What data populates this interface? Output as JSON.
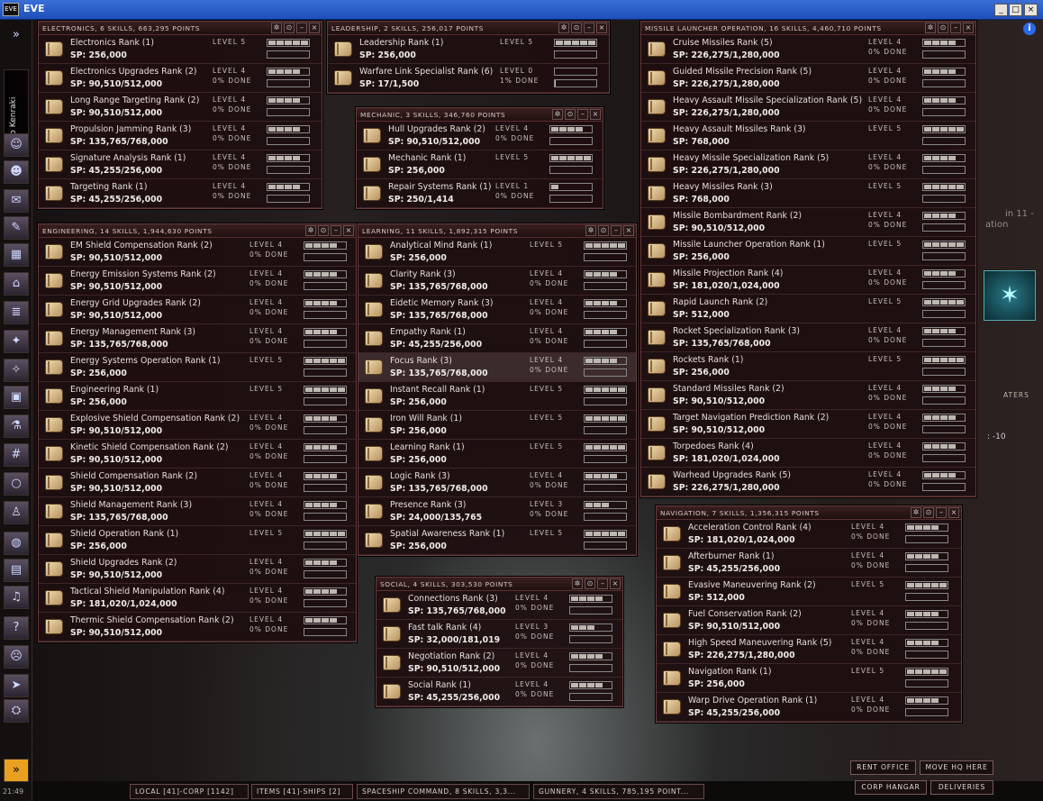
{
  "window": {
    "title": "EVE",
    "logo": "EVE",
    "controls": [
      "_",
      "□",
      "×"
    ]
  },
  "clock": "21:49",
  "character": {
    "name": "Tiso Kenraki"
  },
  "sidebar": {
    "icons": [
      {
        "name": "expand-icon",
        "glyph": "»"
      },
      {
        "name": "character-sheet-icon",
        "glyph": "☺"
      },
      {
        "name": "people-icon",
        "glyph": "☻"
      },
      {
        "name": "mail-icon",
        "glyph": "✉"
      },
      {
        "name": "notepad-icon",
        "glyph": "✎"
      },
      {
        "name": "assets-icon",
        "glyph": "▦"
      },
      {
        "name": "corporation-icon",
        "glyph": "⌂"
      },
      {
        "name": "contracts-icon",
        "glyph": "≣"
      },
      {
        "name": "map-icon",
        "glyph": "✦"
      },
      {
        "name": "starmap-icon",
        "glyph": "✧"
      },
      {
        "name": "wallet-icon",
        "glyph": "▣"
      },
      {
        "name": "science-icon",
        "glyph": "⚗"
      },
      {
        "name": "calculator-icon",
        "glyph": "#"
      },
      {
        "name": "help-lifebuoy-icon",
        "glyph": "○"
      },
      {
        "name": "pilot-icon",
        "glyph": "♙"
      },
      {
        "name": "world-icon",
        "glyph": "◍"
      },
      {
        "name": "journal-icon",
        "glyph": "▤"
      },
      {
        "name": "music-icon",
        "glyph": "♫"
      },
      {
        "name": "help-icon",
        "glyph": "?"
      },
      {
        "name": "agent-icon",
        "glyph": "☹"
      },
      {
        "name": "ship-icon",
        "glyph": "➤"
      },
      {
        "name": "station-icon",
        "glyph": "⛭"
      },
      {
        "name": "collapse-chevrons-icon",
        "glyph": "»"
      }
    ]
  },
  "panels": [
    {
      "id": "electronics",
      "title": "ELECTRONICS, 6 SKILLS, 663,295 POINTS",
      "skills": [
        {
          "name": "Electronics Rank (1)",
          "sp": "SP: 256,000",
          "level": "LEVEL 5",
          "done": "",
          "lvl": 5,
          "progress": 0
        },
        {
          "name": "Electronics Upgrades Rank (2)",
          "sp": "SP: 90,510/512,000",
          "level": "LEVEL 4",
          "done": "0% DONE",
          "lvl": 4,
          "progress": 0
        },
        {
          "name": "Long Range Targeting Rank (2)",
          "sp": "SP: 90,510/512,000",
          "level": "LEVEL 4",
          "done": "0% DONE",
          "lvl": 4,
          "progress": 0
        },
        {
          "name": "Propulsion Jamming Rank (3)",
          "sp": "SP: 135,765/768,000",
          "level": "LEVEL 4",
          "done": "0% DONE",
          "lvl": 4,
          "progress": 0
        },
        {
          "name": "Signature Analysis Rank (1)",
          "sp": "SP: 45,255/256,000",
          "level": "LEVEL 4",
          "done": "0% DONE",
          "lvl": 4,
          "progress": 0
        },
        {
          "name": "Targeting Rank (1)",
          "sp": "SP: 45,255/256,000",
          "level": "LEVEL 4",
          "done": "0% DONE",
          "lvl": 4,
          "progress": 0
        }
      ]
    },
    {
      "id": "leadership",
      "title": "LEADERSHIP, 2 SKILLS, 256,017 POINTS",
      "skills": [
        {
          "name": "Leadership Rank (1)",
          "sp": "SP: 256,000",
          "level": "LEVEL 5",
          "done": "",
          "lvl": 5,
          "progress": 0
        },
        {
          "name": "Warfare Link Specialist Rank (6)",
          "sp": "SP: 17/1,500",
          "level": "LEVEL 0",
          "done": "1% DONE",
          "lvl": 0,
          "progress": 0.01
        }
      ]
    },
    {
      "id": "mechanic",
      "title": "MECHANIC, 3 SKILLS, 346,760 POINTS",
      "skills": [
        {
          "name": "Hull Upgrades Rank (2)",
          "sp": "SP: 90,510/512,000",
          "level": "LEVEL 4",
          "done": "0% DONE",
          "lvl": 4,
          "progress": 0
        },
        {
          "name": "Mechanic Rank (1)",
          "sp": "SP: 256,000",
          "level": "LEVEL 5",
          "done": "",
          "lvl": 5,
          "progress": 0
        },
        {
          "name": "Repair Systems Rank (1)",
          "sp": "SP: 250/1,414",
          "level": "LEVEL 1",
          "done": "0% DONE",
          "lvl": 1,
          "progress": 0
        }
      ]
    },
    {
      "id": "engineering",
      "title": "ENGINEERING, 14 SKILLS, 1,944,630 POINTS",
      "skills": [
        {
          "name": "EM Shield Compensation Rank (2)",
          "sp": "SP: 90,510/512,000",
          "level": "LEVEL 4",
          "done": "0% DONE",
          "lvl": 4,
          "progress": 0
        },
        {
          "name": "Energy Emission Systems Rank (2)",
          "sp": "SP: 90,510/512,000",
          "level": "LEVEL 4",
          "done": "0% DONE",
          "lvl": 4,
          "progress": 0
        },
        {
          "name": "Energy Grid Upgrades Rank (2)",
          "sp": "SP: 90,510/512,000",
          "level": "LEVEL 4",
          "done": "0% DONE",
          "lvl": 4,
          "progress": 0
        },
        {
          "name": "Energy Management Rank (3)",
          "sp": "SP: 135,765/768,000",
          "level": "LEVEL 4",
          "done": "0% DONE",
          "lvl": 4,
          "progress": 0
        },
        {
          "name": "Energy Systems Operation Rank (1)",
          "sp": "SP: 256,000",
          "level": "LEVEL 5",
          "done": "",
          "lvl": 5,
          "progress": 0
        },
        {
          "name": "Engineering Rank (1)",
          "sp": "SP: 256,000",
          "level": "LEVEL 5",
          "done": "",
          "lvl": 5,
          "progress": 0
        },
        {
          "name": "Explosive Shield Compensation Rank (2)",
          "sp": "SP: 90,510/512,000",
          "level": "LEVEL 4",
          "done": "0% DONE",
          "lvl": 4,
          "progress": 0
        },
        {
          "name": "Kinetic Shield Compensation Rank (2)",
          "sp": "SP: 90,510/512,000",
          "level": "LEVEL 4",
          "done": "0% DONE",
          "lvl": 4,
          "progress": 0
        },
        {
          "name": "Shield Compensation Rank (2)",
          "sp": "SP: 90,510/512,000",
          "level": "LEVEL 4",
          "done": "0% DONE",
          "lvl": 4,
          "progress": 0
        },
        {
          "name": "Shield Management Rank (3)",
          "sp": "SP: 135,765/768,000",
          "level": "LEVEL 4",
          "done": "0% DONE",
          "lvl": 4,
          "progress": 0
        },
        {
          "name": "Shield Operation Rank (1)",
          "sp": "SP: 256,000",
          "level": "LEVEL 5",
          "done": "",
          "lvl": 5,
          "progress": 0
        },
        {
          "name": "Shield Upgrades Rank (2)",
          "sp": "SP: 90,510/512,000",
          "level": "LEVEL 4",
          "done": "0% DONE",
          "lvl": 4,
          "progress": 0
        },
        {
          "name": "Tactical Shield Manipulation Rank (4)",
          "sp": "SP: 181,020/1,024,000",
          "level": "LEVEL 4",
          "done": "0% DONE",
          "lvl": 4,
          "progress": 0
        },
        {
          "name": "Thermic Shield Compensation Rank (2)",
          "sp": "SP: 90,510/512,000",
          "level": "LEVEL 4",
          "done": "0% DONE",
          "lvl": 4,
          "progress": 0
        }
      ]
    },
    {
      "id": "learning",
      "title": "LEARNING, 11 SKILLS, 1,892,315 POINTS",
      "skills": [
        {
          "name": "Analytical Mind Rank (1)",
          "sp": "SP: 256,000",
          "level": "LEVEL 5",
          "done": "",
          "lvl": 5,
          "progress": 0
        },
        {
          "name": "Clarity Rank (3)",
          "sp": "SP: 135,765/768,000",
          "level": "LEVEL 4",
          "done": "0% DONE",
          "lvl": 4,
          "progress": 0
        },
        {
          "name": "Eidetic Memory Rank (3)",
          "sp": "SP: 135,765/768,000",
          "level": "LEVEL 4",
          "done": "0% DONE",
          "lvl": 4,
          "progress": 0
        },
        {
          "name": "Empathy Rank (1)",
          "sp": "SP: 45,255/256,000",
          "level": "LEVEL 4",
          "done": "0% DONE",
          "lvl": 4,
          "progress": 0
        },
        {
          "name": "Focus Rank (3)",
          "sp": "SP: 135,765/768,000",
          "level": "LEVEL 4",
          "done": "0% DONE",
          "lvl": 4,
          "progress": 0,
          "selected": true
        },
        {
          "name": "Instant Recall Rank (1)",
          "sp": "SP: 256,000",
          "level": "LEVEL 5",
          "done": "",
          "lvl": 5,
          "progress": 0
        },
        {
          "name": "Iron Will Rank (1)",
          "sp": "SP: 256,000",
          "level": "LEVEL 5",
          "done": "",
          "lvl": 5,
          "progress": 0
        },
        {
          "name": "Learning Rank (1)",
          "sp": "SP: 256,000",
          "level": "LEVEL 5",
          "done": "",
          "lvl": 5,
          "progress": 0
        },
        {
          "name": "Logic Rank (3)",
          "sp": "SP: 135,765/768,000",
          "level": "LEVEL 4",
          "done": "0% DONE",
          "lvl": 4,
          "progress": 0
        },
        {
          "name": "Presence Rank (3)",
          "sp": "SP: 24,000/135,765",
          "level": "LEVEL 3",
          "done": "0% DONE",
          "lvl": 3,
          "progress": 0
        },
        {
          "name": "Spatial Awareness Rank (1)",
          "sp": "SP: 256,000",
          "level": "LEVEL 5",
          "done": "",
          "lvl": 5,
          "progress": 0
        }
      ]
    },
    {
      "id": "social",
      "title": "SOCIAL, 4 SKILLS, 303,530 POINTS",
      "skills": [
        {
          "name": "Connections Rank (3)",
          "sp": "SP: 135,765/768,000",
          "level": "LEVEL 4",
          "done": "0% DONE",
          "lvl": 4,
          "progress": 0
        },
        {
          "name": "Fast talk Rank (4)",
          "sp": "SP: 32,000/181,019",
          "level": "LEVEL 3",
          "done": "0% DONE",
          "lvl": 3,
          "progress": 0
        },
        {
          "name": "Negotiation Rank (2)",
          "sp": "SP: 90,510/512,000",
          "level": "LEVEL 4",
          "done": "0% DONE",
          "lvl": 4,
          "progress": 0
        },
        {
          "name": "Social Rank (1)",
          "sp": "SP: 45,255/256,000",
          "level": "LEVEL 4",
          "done": "0% DONE",
          "lvl": 4,
          "progress": 0
        }
      ]
    },
    {
      "id": "missile",
      "title": "MISSILE LAUNCHER OPERATION, 16 SKILLS, 4,460,710 POINTS",
      "skills": [
        {
          "name": "Cruise Missiles Rank (5)",
          "sp": "SP: 226,275/1,280,000",
          "level": "LEVEL 4",
          "done": "0% DONE",
          "lvl": 4,
          "progress": 0
        },
        {
          "name": "Guided Missile Precision Rank (5)",
          "sp": "SP: 226,275/1,280,000",
          "level": "LEVEL 4",
          "done": "0% DONE",
          "lvl": 4,
          "progress": 0
        },
        {
          "name": "Heavy Assault Missile Specialization Rank (5)",
          "sp": "SP: 226,275/1,280,000",
          "level": "LEVEL 4",
          "done": "0% DONE",
          "lvl": 4,
          "progress": 0
        },
        {
          "name": "Heavy Assault Missiles Rank (3)",
          "sp": "SP: 768,000",
          "level": "LEVEL 5",
          "done": "",
          "lvl": 5,
          "progress": 0
        },
        {
          "name": "Heavy Missile Specialization Rank (5)",
          "sp": "SP: 226,275/1,280,000",
          "level": "LEVEL 4",
          "done": "0% DONE",
          "lvl": 4,
          "progress": 0
        },
        {
          "name": "Heavy Missiles Rank (3)",
          "sp": "SP: 768,000",
          "level": "LEVEL 5",
          "done": "",
          "lvl": 5,
          "progress": 0
        },
        {
          "name": "Missile Bombardment Rank (2)",
          "sp": "SP: 90,510/512,000",
          "level": "LEVEL 4",
          "done": "0% DONE",
          "lvl": 4,
          "progress": 0
        },
        {
          "name": "Missile Launcher Operation Rank (1)",
          "sp": "SP: 256,000",
          "level": "LEVEL 5",
          "done": "",
          "lvl": 5,
          "progress": 0
        },
        {
          "name": "Missile Projection Rank (4)",
          "sp": "SP: 181,020/1,024,000",
          "level": "LEVEL 4",
          "done": "0% DONE",
          "lvl": 4,
          "progress": 0
        },
        {
          "name": "Rapid Launch Rank (2)",
          "sp": "SP: 512,000",
          "level": "LEVEL 5",
          "done": "",
          "lvl": 5,
          "progress": 0
        },
        {
          "name": "Rocket Specialization Rank (3)",
          "sp": "SP: 135,765/768,000",
          "level": "LEVEL 4",
          "done": "0% DONE",
          "lvl": 4,
          "progress": 0
        },
        {
          "name": "Rockets Rank (1)",
          "sp": "SP: 256,000",
          "level": "LEVEL 5",
          "done": "",
          "lvl": 5,
          "progress": 0
        },
        {
          "name": "Standard Missiles Rank (2)",
          "sp": "SP: 90,510/512,000",
          "level": "LEVEL 4",
          "done": "0% DONE",
          "lvl": 4,
          "progress": 0
        },
        {
          "name": "Target Navigation Prediction Rank (2)",
          "sp": "SP: 90,510/512,000",
          "level": "LEVEL 4",
          "done": "0% DONE",
          "lvl": 4,
          "progress": 0
        },
        {
          "name": "Torpedoes Rank (4)",
          "sp": "SP: 181,020/1,024,000",
          "level": "LEVEL 4",
          "done": "0% DONE",
          "lvl": 4,
          "progress": 0
        },
        {
          "name": "Warhead Upgrades Rank (5)",
          "sp": "SP: 226,275/1,280,000",
          "level": "LEVEL 4",
          "done": "0% DONE",
          "lvl": 4,
          "progress": 0
        }
      ]
    },
    {
      "id": "navigation",
      "title": "NAVIGATION, 7 SKILLS, 1,356,315 POINTS",
      "skills": [
        {
          "name": "Acceleration Control Rank (4)",
          "sp": "SP: 181,020/1,024,000",
          "level": "LEVEL 4",
          "done": "0% DONE",
          "lvl": 4,
          "progress": 0
        },
        {
          "name": "Afterburner Rank (1)",
          "sp": "SP: 45,255/256,000",
          "level": "LEVEL 4",
          "done": "0% DONE",
          "lvl": 4,
          "progress": 0
        },
        {
          "name": "Evasive Maneuvering Rank (2)",
          "sp": "SP: 512,000",
          "level": "LEVEL 5",
          "done": "",
          "lvl": 5,
          "progress": 0
        },
        {
          "name": "Fuel Conservation Rank (2)",
          "sp": "SP: 90,510/512,000",
          "level": "LEVEL 4",
          "done": "0% DONE",
          "lvl": 4,
          "progress": 0
        },
        {
          "name": "High Speed Maneuvering Rank (5)",
          "sp": "SP: 226,275/1,280,000",
          "level": "LEVEL 4",
          "done": "0% DONE",
          "lvl": 4,
          "progress": 0
        },
        {
          "name": "Navigation Rank (1)",
          "sp": "SP: 256,000",
          "level": "LEVEL 5",
          "done": "",
          "lvl": 5,
          "progress": 0
        },
        {
          "name": "Warp Drive Operation Rank (1)",
          "sp": "SP: 45,255/256,000",
          "level": "LEVEL 4",
          "done": "0% DONE",
          "lvl": 4,
          "progress": 0
        }
      ]
    }
  ],
  "panel_controls": [
    "✲",
    "⊙",
    "–",
    "×"
  ],
  "taskbar": [
    "LOCAL [41]-CORP [1142]",
    "ITEMS [41]-SHIPS [2]",
    "SPACESHIP COMMAND, 8 SKILLS, 3,3...",
    "GUNNERY, 4 SKILLS, 785,195 POINT..."
  ],
  "station_buttons": {
    "rent_office": "RENT OFFICE",
    "move_hq": "MOVE HQ HERE",
    "corp_hangar": "CORP HANGAR",
    "deliveries": "DELIVERIES"
  },
  "background_text": {
    "fragment1": "in 11 -",
    "fragment2": "ation",
    "fragment3": "ATERS",
    "fragment4": ": -10"
  }
}
